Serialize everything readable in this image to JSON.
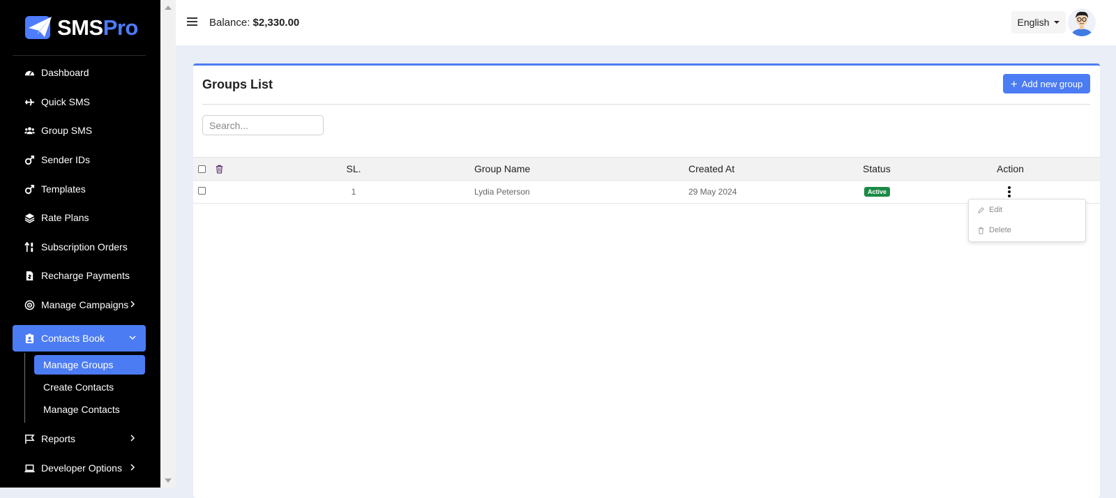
{
  "app": {
    "logo_main": "SMS",
    "logo_accent": "Pro"
  },
  "sidebar": {
    "items": [
      {
        "label": "Dashboard",
        "icon": "gauge-icon"
      },
      {
        "label": "Quick SMS",
        "icon": "plane-icon"
      },
      {
        "label": "Group SMS",
        "icon": "users-icon"
      },
      {
        "label": "Sender IDs",
        "icon": "mars-icon"
      },
      {
        "label": "Templates",
        "icon": "mars-icon"
      },
      {
        "label": "Rate Plans",
        "icon": "layers-icon"
      },
      {
        "label": "Subscription Orders",
        "icon": "sort-icon"
      },
      {
        "label": "Recharge Payments",
        "icon": "invoice-icon"
      },
      {
        "label": "Manage Campaigns",
        "icon": "target-icon"
      },
      {
        "label": "Contacts Book",
        "icon": "address-book-icon"
      },
      {
        "label": "Reports",
        "icon": "flag-icon"
      },
      {
        "label": "Developer Options",
        "icon": "laptop-icon"
      }
    ],
    "contacts_sub": [
      {
        "label": "Manage Groups"
      },
      {
        "label": "Create Contacts"
      },
      {
        "label": "Manage Contacts"
      }
    ]
  },
  "header": {
    "balance_label": "Balance:",
    "balance_value": "$2,330.00",
    "language": "English"
  },
  "main": {
    "title": "Groups List",
    "add_button": "Add new group",
    "search_placeholder": "Search...",
    "table": {
      "columns": [
        "SL.",
        "Group Name",
        "Created At",
        "Status",
        "Action"
      ],
      "rows": [
        {
          "sl": "1",
          "group_name": "Lydia Peterson",
          "created_at": "29 May 2024",
          "status": "Active"
        }
      ]
    },
    "action_menu": {
      "edit": "Edit",
      "delete": "Delete"
    }
  },
  "colors": {
    "primary": "#4c7cf3",
    "sidebar_bg": "#000000",
    "status_active": "#1a8a46"
  }
}
